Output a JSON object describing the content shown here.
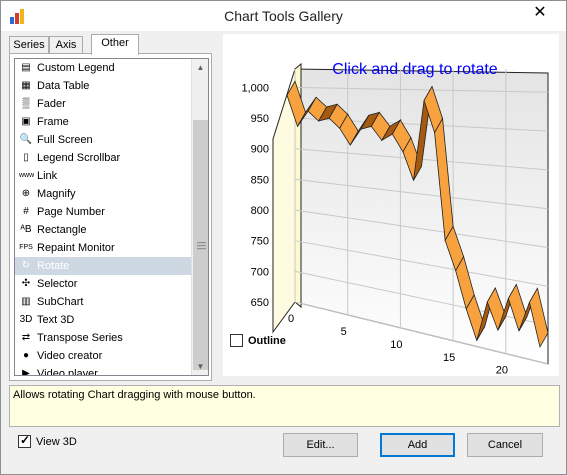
{
  "window": {
    "title": "Chart Tools Gallery",
    "close_glyph": "✕"
  },
  "tabs": [
    {
      "label": "Series",
      "active": false
    },
    {
      "label": "Axis",
      "active": false
    },
    {
      "label": "Other",
      "active": true
    }
  ],
  "tools": [
    {
      "label": "Custom Legend",
      "icon": "custom-legend-icon",
      "glyph": "▤"
    },
    {
      "label": "Data Table",
      "icon": "data-table-icon",
      "glyph": "▦"
    },
    {
      "label": "Fader",
      "icon": "fader-icon",
      "glyph": "▒"
    },
    {
      "label": "Frame",
      "icon": "frame-icon",
      "glyph": "▣"
    },
    {
      "label": "Full Screen",
      "icon": "magnifier-icon",
      "glyph": "🔍"
    },
    {
      "label": "Legend Scrollbar",
      "icon": "legend-scrollbar-icon",
      "glyph": "▯"
    },
    {
      "label": "Link",
      "icon": "link-icon",
      "glyph": "www"
    },
    {
      "label": "Magnify",
      "icon": "magnify-icon",
      "glyph": "⊕"
    },
    {
      "label": "Page Number",
      "icon": "page-number-icon",
      "glyph": "#"
    },
    {
      "label": "Rectangle",
      "icon": "rectangle-icon",
      "glyph": "ᴬB"
    },
    {
      "label": "Repaint Monitor",
      "icon": "fps-icon",
      "glyph": "FPS"
    },
    {
      "label": "Rotate",
      "icon": "rotate-icon",
      "glyph": "↻",
      "selected": true
    },
    {
      "label": "Selector",
      "icon": "selector-icon",
      "glyph": "✣"
    },
    {
      "label": "SubChart",
      "icon": "subchart-icon",
      "glyph": "▥"
    },
    {
      "label": "Text 3D",
      "icon": "text-3d-icon",
      "glyph": "3D"
    },
    {
      "label": "Transpose Series",
      "icon": "transpose-icon",
      "glyph": "⇄"
    },
    {
      "label": "Video creator",
      "icon": "video-creator-icon",
      "glyph": "●"
    },
    {
      "label": "Video player",
      "icon": "video-player-icon",
      "glyph": "▶"
    }
  ],
  "chart": {
    "overlay_text": "Click and drag to rotate",
    "overlay_color": "#0000ff",
    "series_color": "#f7a23f",
    "series_dark_color": "#a65a10",
    "outline_label": "Outline",
    "outline_checked": false
  },
  "chart_data": {
    "type": "line",
    "title": "",
    "xlabel": "",
    "ylabel": "",
    "x": [
      0,
      1,
      2,
      3,
      4,
      5,
      6,
      7,
      8,
      9,
      10,
      11,
      12,
      13,
      14,
      15,
      16,
      17,
      18,
      19,
      20,
      21,
      22,
      23,
      24
    ],
    "values": [
      1010,
      960,
      985,
      970,
      975,
      960,
      935,
      960,
      965,
      945,
      955,
      930,
      890,
      1005,
      960,
      810,
      770,
      720,
      680,
      735,
      700,
      745,
      705,
      745,
      690
    ],
    "ylim": [
      650,
      1030
    ],
    "xlim": [
      0,
      24
    ],
    "y_ticks": [
      "1,000",
      "950",
      "900",
      "850",
      "800",
      "750",
      "700",
      "650"
    ],
    "x_ticks": [
      "0",
      "5",
      "10",
      "15",
      "20"
    ],
    "grid": true,
    "three_d": true
  },
  "description": {
    "text": "Allows rotating Chart dragging with mouse button."
  },
  "footer": {
    "view3d_label": "View 3D",
    "view3d_checked": true,
    "edit_label": "Edit...",
    "add_label": "Add",
    "cancel_label": "Cancel"
  }
}
